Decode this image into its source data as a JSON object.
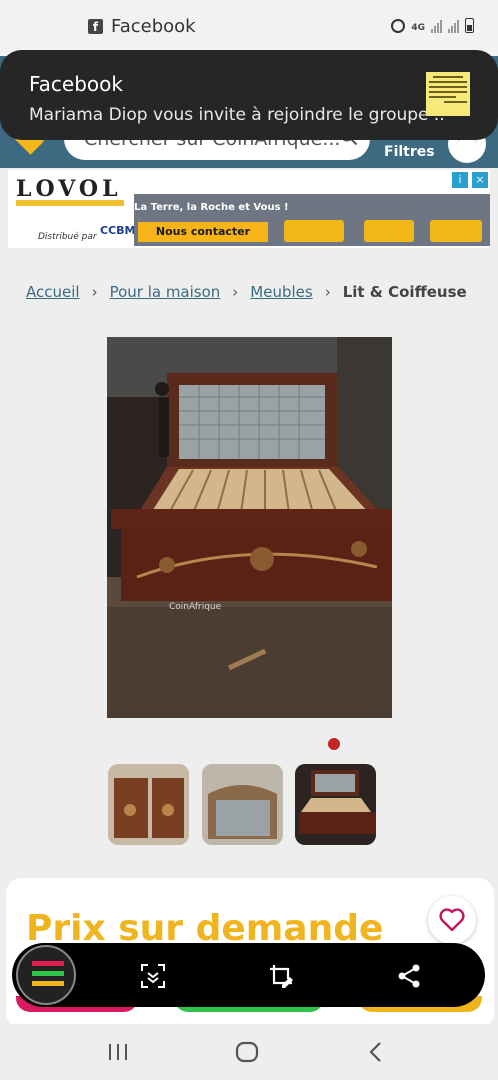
{
  "status_bar": {
    "app_name": "Facebook",
    "network_label": "4G"
  },
  "notification": {
    "title": "Facebook",
    "message": "Mariama Diop vous invite à rejoindre le groupe .."
  },
  "header": {
    "search_placeholder": "Chercher sur CoinAfrique...",
    "filters_label": "Filtres"
  },
  "ad": {
    "brand": "LOVOL",
    "distributed_by": "Distribué par",
    "distributor": "CCBM",
    "tagline": "La Terre, la Roche et Vous !",
    "cta_label": "Nous contacter"
  },
  "breadcrumb": [
    {
      "label": "Accueil",
      "link": true
    },
    {
      "label": "Pour la maison",
      "link": true
    },
    {
      "label": "Meubles",
      "link": true
    },
    {
      "label": "Lit & Coiffeuse",
      "link": false
    }
  ],
  "breadcrumb_separator": "›",
  "listing": {
    "watermark": "CoinAfrique",
    "gallery_count": 3,
    "price_label": "Prix sur demande"
  },
  "colors": {
    "brand_header": "#3d6a80",
    "accent_yellow": "#f0b41e",
    "gallery_dot": "#c02626",
    "heart": "#c2185b"
  },
  "screenshot_toolbar": {
    "icons": [
      "scroll-capture-icon",
      "crop-edit-icon",
      "share-icon"
    ]
  },
  "navigation_bar": {
    "icons": [
      "recent-apps-icon",
      "home-icon",
      "back-icon"
    ]
  }
}
